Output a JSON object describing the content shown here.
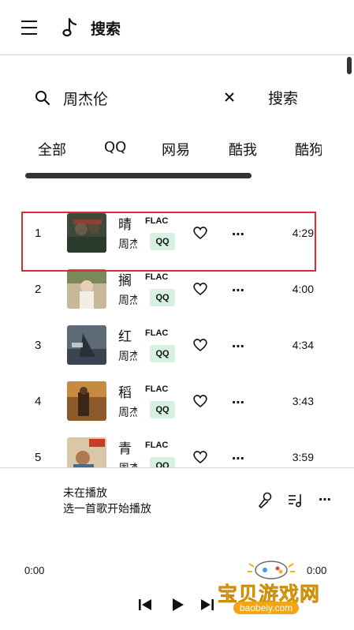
{
  "header": {
    "title": "搜索",
    "menu_icon": "hamburger-menu-icon",
    "app_icon": "music-note-icon"
  },
  "search": {
    "value": "周杰伦",
    "button_label": "搜索"
  },
  "tabs": [
    {
      "label": "全部"
    },
    {
      "label": "QQ"
    },
    {
      "label": "网易"
    },
    {
      "label": "酷我"
    },
    {
      "label": "酷狗"
    }
  ],
  "songs": [
    {
      "index": "1",
      "title": "晴",
      "artist": "周杰伦",
      "quality": "FLAC",
      "source": "QQ",
      "duration": "4:29",
      "selected": true
    },
    {
      "index": "2",
      "title": "搁",
      "artist": "周杰伦",
      "quality": "FLAC",
      "source": "QQ",
      "duration": "4:00"
    },
    {
      "index": "3",
      "title": "红",
      "artist": "周杰伦",
      "quality": "FLAC",
      "source": "QQ",
      "duration": "4:34"
    },
    {
      "index": "4",
      "title": "稻",
      "artist": "周杰伦",
      "quality": "FLAC",
      "source": "QQ",
      "duration": "3:43"
    },
    {
      "index": "5",
      "title": "青",
      "artist": "周杰伦",
      "quality": "FLAC",
      "source": "QQ",
      "duration": "3:59"
    }
  ],
  "player": {
    "title": "未在播放",
    "subtitle": "选一首歌开始播放",
    "elapsed": "0:00",
    "total": "0:00",
    "progress": 0
  },
  "watermark": {
    "text": "宝贝游戏网",
    "url": "baobeiy.com"
  },
  "colors": {
    "accent_red": "#d32f2f",
    "qq_badge_bg": "#d6f0e2",
    "watermark_gold": "#f2b21d"
  }
}
